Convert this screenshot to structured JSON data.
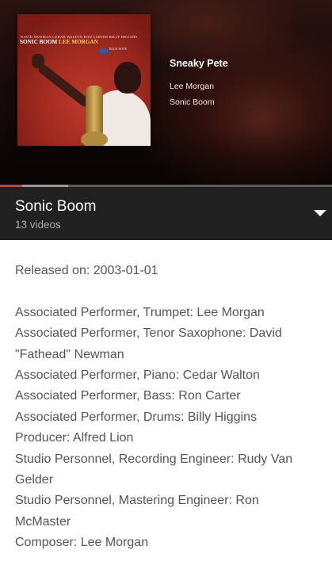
{
  "player": {
    "track_title": "Sneaky Pete",
    "artist": "Lee Morgan",
    "album": "Sonic Boom",
    "progress_played": 0.067,
    "progress_buffered": 0.205,
    "album_art": {
      "credits_line": "DAVID NEWMAN  CEDAR WALTON  RON CARTER  BILLY HIGGINS",
      "title_part1": "SONIC BOOM",
      "title_part2": "LEE MORGAN",
      "logo_text": "BLUE NOTE",
      "accent_color": "#c0392b"
    }
  },
  "playlist": {
    "title": "Sonic Boom",
    "count": "13 videos",
    "expand_icon": "chevron-down-icon"
  },
  "description": {
    "released": "Released on: 2003-01-01",
    "credits": [
      "Associated  Performer, Trumpet: Lee Morgan",
      "Associated  Performer, Tenor  Saxophone: David \"Fathead\" Newman",
      "Associated  Performer, Piano: Cedar Walton",
      "Associated  Performer, Bass: Ron Carter",
      "Associated  Performer, Drums: Billy Higgins",
      "Producer: Alfred Lion",
      "Studio  Personnel, Recording  Engineer: Rudy Van Gelder",
      "Studio  Personnel, Mastering  Engineer: Ron McMaster",
      "Composer: Lee Morgan"
    ]
  },
  "colors": {
    "progress_played": "#e5382b",
    "bar_background": "#212121",
    "description_text": "#555555"
  }
}
